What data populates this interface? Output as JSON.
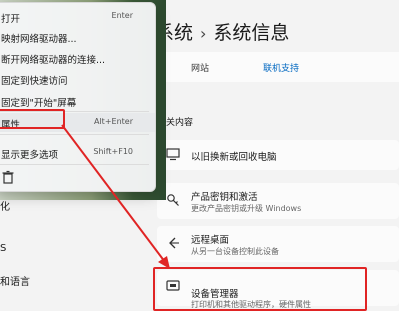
{
  "sidebar": {
    "items": [
      "化",
      "S",
      "和语言"
    ]
  },
  "header": {
    "breadcrumb_parent": "系统",
    "breadcrumb_sep": "›",
    "breadcrumb_current": "系统信息"
  },
  "info": {
    "key": "网站",
    "value": "联机支持"
  },
  "related": {
    "section_title": "相关内容",
    "items": [
      {
        "title": "以旧换新或回收电脑",
        "subtitle": ""
      },
      {
        "title": "产品密钥和激活",
        "subtitle": "更改产品密钥或升级 Windows"
      },
      {
        "title": "远程桌面",
        "subtitle": "从另一台设备控制此设备"
      },
      {
        "title": "设备管理器",
        "subtitle": "打印机和其他驱动程序，硬件属性"
      }
    ]
  },
  "context_menu": {
    "items": [
      {
        "label": "打开",
        "shortcut": "Enter"
      },
      {
        "label": "映射网络驱动器...",
        "shortcut": ""
      },
      {
        "label": "断开网络驱动器的连接...",
        "shortcut": ""
      },
      {
        "label": "固定到快速访问",
        "shortcut": ""
      },
      {
        "label": "固定到\"开始\"屏幕",
        "shortcut": ""
      },
      {
        "label": "属性",
        "shortcut": "Alt+Enter"
      },
      {
        "label": "显示更多选项",
        "shortcut": "Shift+F10"
      }
    ]
  },
  "colors": {
    "highlight_red": "#e02424",
    "link_blue": "#0067c0"
  },
  "icons": [
    "monitor-icon",
    "key-icon",
    "remote-desktop-icon",
    "device-manager-icon",
    "trash-icon"
  ]
}
